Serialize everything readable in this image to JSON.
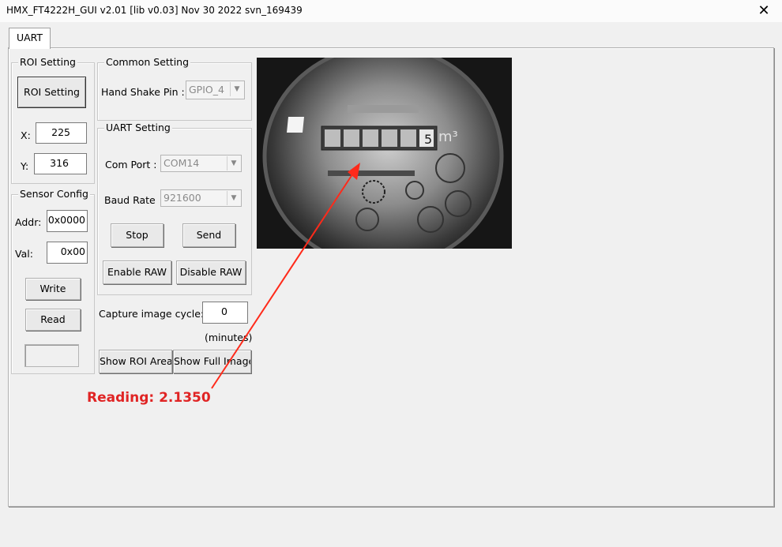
{
  "window": {
    "title": "HMX_FT4222H_GUI v2.01 [lib v0.03] Nov 30 2022 svn_169439",
    "close_glyph": "✕"
  },
  "tabs": [
    {
      "label": "UART"
    }
  ],
  "roi": {
    "legend": "ROI Setting",
    "button_label": "ROI Setting",
    "x_label": "X:",
    "x_value": "225",
    "y_label": "Y:",
    "y_value": "316"
  },
  "sensor": {
    "legend": "Sensor Config",
    "addr_label": "Addr:",
    "addr_value": "0x0000",
    "val_label": "Val:",
    "val_value": "0x00",
    "write_label": "Write",
    "read_label": "Read"
  },
  "common": {
    "legend": "Common Setting",
    "handshake_label": "Hand Shake Pin :",
    "handshake_value": "GPIO_4"
  },
  "uart": {
    "legend": "UART Setting",
    "port_label": "Com Port :",
    "port_value": "COM14",
    "baud_label": "Baud Rate",
    "baud_value": "921600",
    "stop_label": "Stop",
    "send_label": "Send",
    "enable_raw_label": "Enable RAW",
    "disable_raw_label": "Disable RAW"
  },
  "capture": {
    "label": "Capture image cycle:",
    "value": "0",
    "unit": "(minutes)"
  },
  "view": {
    "show_roi_label": "Show ROI Area",
    "show_full_label": "Show Full Image"
  },
  "meter_image": {
    "register_digits": "5",
    "unit": "m³"
  },
  "annotation": {
    "reading_text": "Reading: 2.1350",
    "color": "#e02424"
  }
}
